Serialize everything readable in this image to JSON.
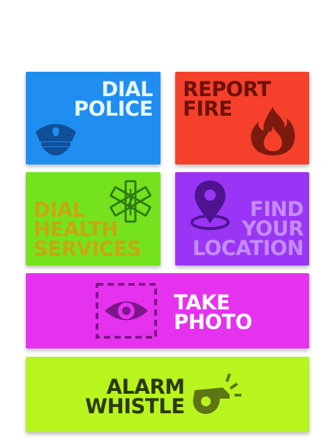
{
  "tiles": {
    "police": {
      "line1": "DIAL",
      "line2": "POLICE",
      "icon": "police-cap-icon",
      "bg": "#1f8ef0",
      "text_color": "#e6f6ff",
      "icon_color": "#0f4f98"
    },
    "fire": {
      "line1": "REPORT",
      "line2": "FIRE",
      "icon": "flame-icon",
      "bg": "#f5402c",
      "text_color": "#6e1208",
      "icon_color": "#7d1a0e"
    },
    "health": {
      "line1": "DIAL",
      "line2": "HEALTH",
      "line3": "SERVICES",
      "icon": "star-of-life-icon",
      "bg": "#74e31e",
      "text_color": "#c8a70f",
      "icon_color": "#2f7a16"
    },
    "location": {
      "line1": "FIND",
      "line2": "YOUR",
      "line3": "LOCATION",
      "icon": "map-pin-icon",
      "bg": "#9a35f5",
      "text_color": "#c48cfb",
      "icon_color": "#4e1490"
    },
    "photo": {
      "line1": "TAKE",
      "line2": "PHOTO",
      "icon": "eye-viewfinder-icon",
      "bg": "#e532ef",
      "text_color": "#ffffff",
      "icon_color": "#7d1687"
    },
    "whistle": {
      "line1": "ALARM",
      "line2": "WHISTLE",
      "icon": "whistle-icon",
      "bg": "#b8f41e",
      "text_color": "#2d3a06",
      "icon_color": "#5d7514"
    }
  }
}
